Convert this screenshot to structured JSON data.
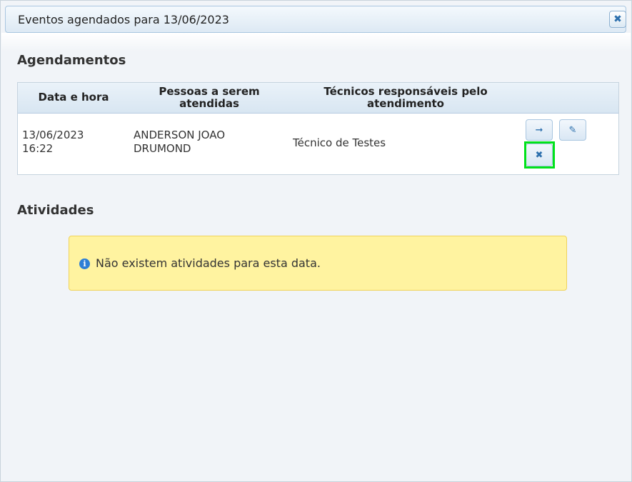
{
  "dialog": {
    "title": "Eventos agendados para 13/06/2023",
    "close_glyph": "✖"
  },
  "appointments": {
    "heading": "Agendamentos",
    "columns": [
      "Data e hora",
      "Pessoas a serem atendidas",
      "Técnicos responsáveis pelo atendimento",
      ""
    ],
    "rows": [
      {
        "date_time": "13/06/2023 16:22",
        "people": "ANDERSON JOAO DRUMOND",
        "technicians": "Técnico de Testes",
        "actions": {
          "go_glyph": "➞",
          "edit_glyph": "✎",
          "delete_glyph": "✖"
        }
      }
    ]
  },
  "activities": {
    "heading": "Atividades",
    "empty_message": "Não existem atividades para esta data.",
    "info_glyph": "i"
  }
}
